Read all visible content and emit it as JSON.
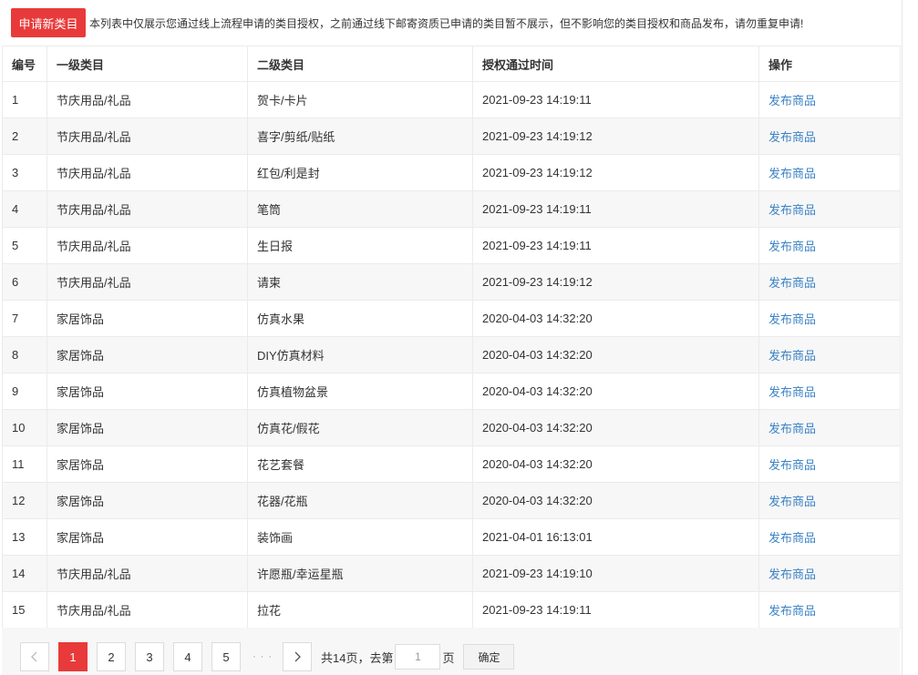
{
  "toolbar": {
    "apply_label": "申请新类目",
    "notice": "本列表中仅展示您通过线上流程申请的类目授权，之前通过线下邮寄资质已申请的类目暂不展示，但不影响您的类目授权和商品发布，请勿重复申请!"
  },
  "table": {
    "headers": {
      "no": "编号",
      "level1": "一级类目",
      "level2": "二级类目",
      "time": "授权通过时间",
      "op": "操作"
    },
    "rows": [
      {
        "no": "1",
        "level1": "节庆用品/礼品",
        "level2": "贺卡/卡片",
        "time": "2021-09-23 14:19:11",
        "op": "发布商品"
      },
      {
        "no": "2",
        "level1": "节庆用品/礼品",
        "level2": "喜字/剪纸/贴纸",
        "time": "2021-09-23 14:19:12",
        "op": "发布商品"
      },
      {
        "no": "3",
        "level1": "节庆用品/礼品",
        "level2": "红包/利是封",
        "time": "2021-09-23 14:19:12",
        "op": "发布商品"
      },
      {
        "no": "4",
        "level1": "节庆用品/礼品",
        "level2": "笔筒",
        "time": "2021-09-23 14:19:11",
        "op": "发布商品"
      },
      {
        "no": "5",
        "level1": "节庆用品/礼品",
        "level2": "生日报",
        "time": "2021-09-23 14:19:11",
        "op": "发布商品"
      },
      {
        "no": "6",
        "level1": "节庆用品/礼品",
        "level2": "请柬",
        "time": "2021-09-23 14:19:12",
        "op": "发布商品"
      },
      {
        "no": "7",
        "level1": "家居饰品",
        "level2": "仿真水果",
        "time": "2020-04-03 14:32:20",
        "op": "发布商品"
      },
      {
        "no": "8",
        "level1": "家居饰品",
        "level2": "DIY仿真材料",
        "time": "2020-04-03 14:32:20",
        "op": "发布商品"
      },
      {
        "no": "9",
        "level1": "家居饰品",
        "level2": "仿真植物盆景",
        "time": "2020-04-03 14:32:20",
        "op": "发布商品"
      },
      {
        "no": "10",
        "level1": "家居饰品",
        "level2": "仿真花/假花",
        "time": "2020-04-03 14:32:20",
        "op": "发布商品"
      },
      {
        "no": "11",
        "level1": "家居饰品",
        "level2": "花艺套餐",
        "time": "2020-04-03 14:32:20",
        "op": "发布商品"
      },
      {
        "no": "12",
        "level1": "家居饰品",
        "level2": "花器/花瓶",
        "time": "2020-04-03 14:32:20",
        "op": "发布商品"
      },
      {
        "no": "13",
        "level1": "家居饰品",
        "level2": "装饰画",
        "time": "2021-04-01 16:13:01",
        "op": "发布商品"
      },
      {
        "no": "14",
        "level1": "节庆用品/礼品",
        "level2": "许愿瓶/幸运星瓶",
        "time": "2021-09-23 14:19:10",
        "op": "发布商品"
      },
      {
        "no": "15",
        "level1": "节庆用品/礼品",
        "level2": "拉花",
        "time": "2021-09-23 14:19:11",
        "op": "发布商品"
      }
    ]
  },
  "pager": {
    "pages": [
      "1",
      "2",
      "3",
      "4",
      "5"
    ],
    "current": "1",
    "ellipsis": "· · ·",
    "total_text": "共14页，去第",
    "goto_value": "1",
    "page_unit": "页",
    "confirm_label": "确定"
  },
  "icons": {
    "prev": "chevron-left-icon",
    "next": "chevron-right-icon"
  },
  "colors": {
    "accent": "#e83a3a",
    "link": "#3b82c4",
    "row_alt": "#f7f7f7"
  }
}
